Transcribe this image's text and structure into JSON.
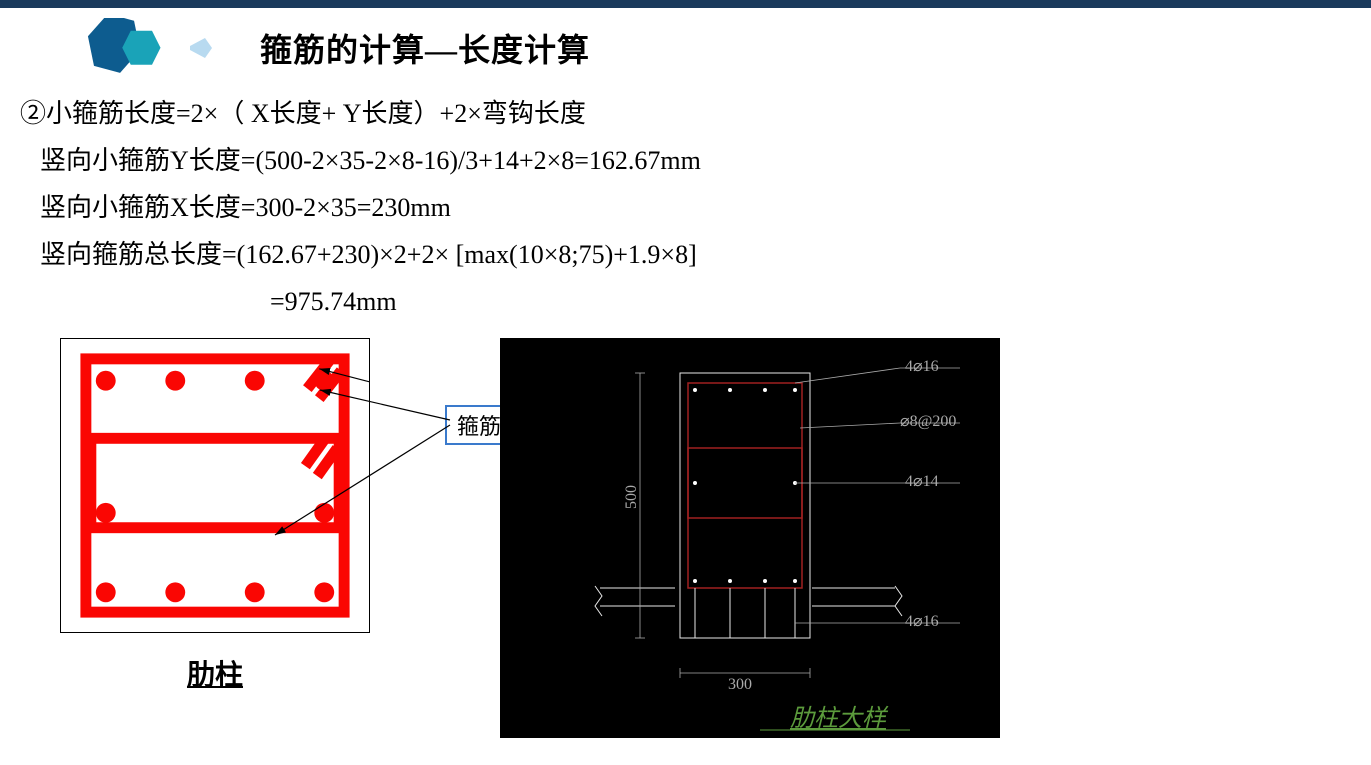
{
  "title": "箍筋的计算—长度计算",
  "formulas": {
    "line1": "②小箍筋长度=2×（ X长度+ Y长度）+2×弯钩长度",
    "line2": "竖向小箍筋Y长度=(500-2×35-2×8-16)/3+14+2×8=162.67mm",
    "line3": "竖向小箍筋X长度=300-2×35=230mm",
    "line4": "竖向箍筋总长度=(162.67+230)×2+2× [max(10×8;75)+1.9×8]",
    "line5": "=975.74mm"
  },
  "diagram": {
    "stirrup_label": "箍筋",
    "rib_column_label": "肋柱",
    "cad_title": "肋柱大样",
    "annotations": {
      "dim_300": "300",
      "dim_500": "500",
      "bar_4d16_top": "4⌀16",
      "bar_d8_200": "⌀8@200",
      "bar_4d14": "4⌀14",
      "bar_4d16_bot": "4⌀16"
    }
  }
}
